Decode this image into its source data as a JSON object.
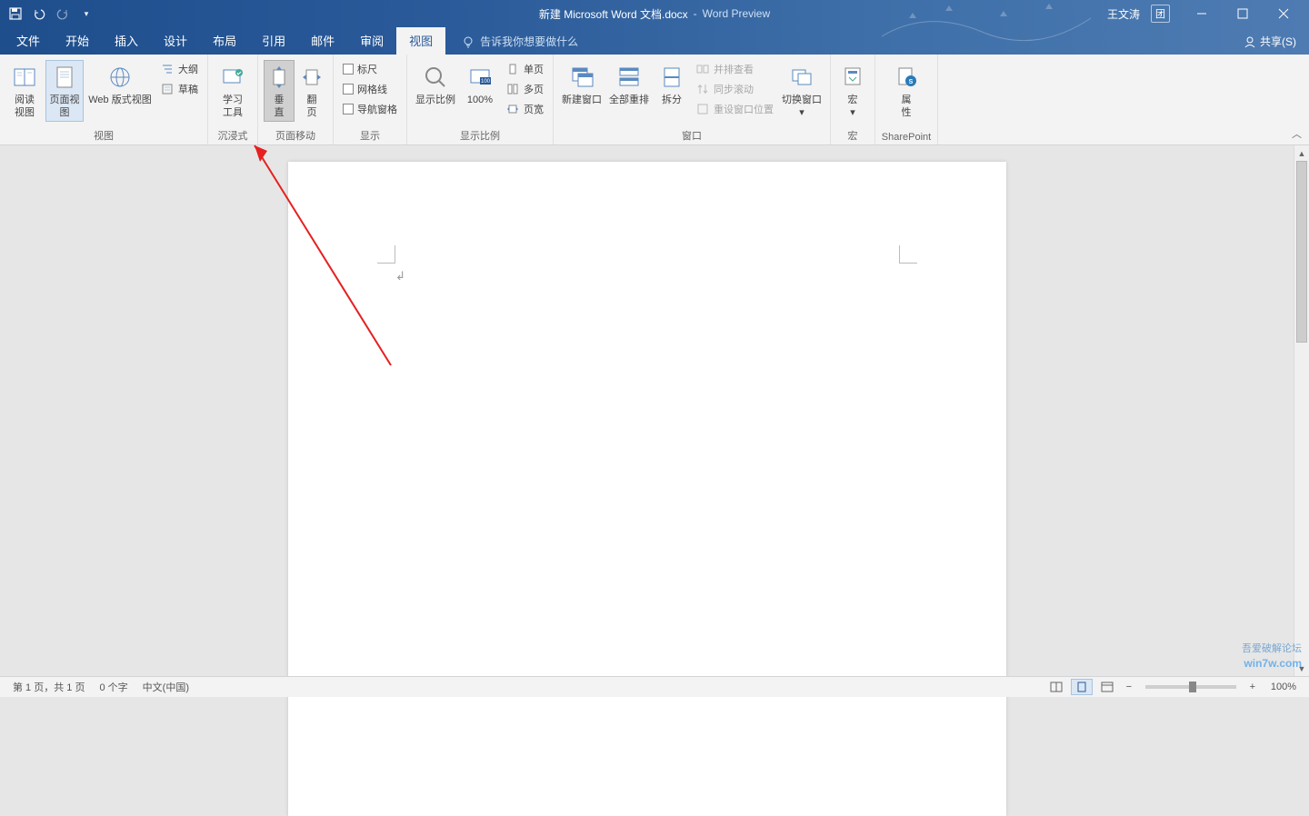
{
  "title": {
    "document": "新建 Microsoft Word 文档.docx",
    "separator": "-",
    "app": "Word Preview",
    "user": "王文涛",
    "team_icon": "团"
  },
  "qat": {
    "save": "保存",
    "undo": "撤销",
    "redo": "重做",
    "customize": "▾"
  },
  "tabs": {
    "file": "文件",
    "home": "开始",
    "insert": "插入",
    "design": "设计",
    "layout": "布局",
    "references": "引用",
    "mail": "邮件",
    "review": "审阅",
    "view": "视图"
  },
  "tell_me": "告诉我你想要做什么",
  "share": "共享(S)",
  "ribbon": {
    "groups": {
      "views": {
        "label": "视图",
        "read": "阅读\n视图",
        "page": "页面视图",
        "web": "Web 版式视图",
        "outline": "大纲",
        "draft": "草稿"
      },
      "immersive": {
        "label": "沉浸式",
        "learning": "学习\n工具"
      },
      "pagemove": {
        "label": "页面移动",
        "vertical": "垂\n直",
        "flip": "翻\n页"
      },
      "show": {
        "label": "显示",
        "ruler": "标尺",
        "grid": "网格线",
        "nav": "导航窗格"
      },
      "zoom": {
        "label": "显示比例",
        "zoom": "显示比例",
        "hundred": "100%",
        "one": "单页",
        "multi": "多页",
        "width": "页宽"
      },
      "window": {
        "label": "窗口",
        "new": "新建窗口",
        "arrange": "全部重排",
        "split": "拆分",
        "side": "并排查看",
        "sync": "同步滚动",
        "reset": "重设窗口位置",
        "switch": "切换窗口"
      },
      "macro": {
        "label": "宏",
        "macro": "宏"
      },
      "sharepoint": {
        "label": "SharePoint",
        "prop": "属\n性"
      }
    }
  },
  "status": {
    "page": "第 1 页，共 1 页",
    "words": "0 个字",
    "lang": "中文(中国)",
    "zoom": "100%"
  },
  "watermark1": "win7w.com",
  "watermark2": "吾爱破解论坛"
}
